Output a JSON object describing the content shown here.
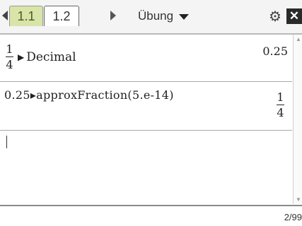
{
  "toolbar": {
    "tabs": [
      {
        "label": "1.1"
      },
      {
        "label": "1.2"
      }
    ],
    "document_title": "Übung"
  },
  "history": [
    {
      "input_fraction": {
        "numerator": "1",
        "denominator": "4"
      },
      "input_operator": "Decimal",
      "result": "0.25"
    },
    {
      "input_text": "0.25▸approxFraction(5.e-14)",
      "result_fraction": {
        "numerator": "1",
        "denominator": "4"
      }
    }
  ],
  "status": {
    "page_counter": "2/99"
  },
  "icons": {
    "nav_left": "triangle-left-icon",
    "nav_right": "triangle-right-icon",
    "title_caret": "caret-down-icon",
    "status": "gear-cluster-icon",
    "close": "close-icon"
  }
}
